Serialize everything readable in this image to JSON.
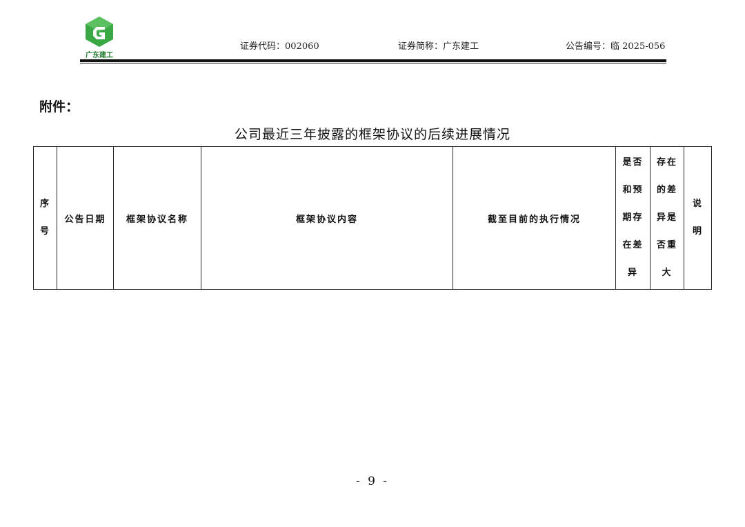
{
  "header": {
    "logo_text": "广东建工",
    "stock_code": "证券代码：002060",
    "stock_abbr": "证券简称：广东建工",
    "announcement_no": "公告编号：临 2025-056",
    "colors": {
      "logo_green": "#3aa845",
      "logo_dark_green": "#1f7a2e"
    }
  },
  "attachment_label": "附件：",
  "title": "公司最近三年披露的框架协议的后续进展情况",
  "table": {
    "headers": {
      "seq": [
        "序",
        "号"
      ],
      "date": "公告日期",
      "name": "框架协议名称",
      "content": "框架协议内容",
      "progress": "截至目前的执行情况",
      "diff": [
        "是否",
        "和预",
        "期存",
        "在差",
        "异"
      ],
      "major": [
        "存在",
        "的差",
        "异是",
        "否重",
        "大"
      ],
      "note": [
        "说",
        "明"
      ]
    }
  },
  "page_number": "- 9 -"
}
